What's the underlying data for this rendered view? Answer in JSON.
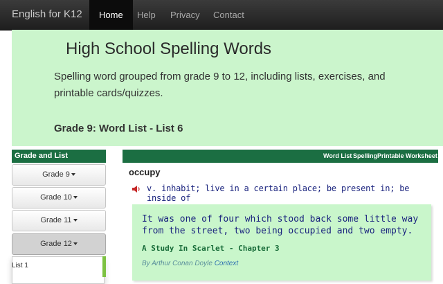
{
  "nav": {
    "brand": "English for K12",
    "items": [
      {
        "label": "Home",
        "active": true
      },
      {
        "label": "Help"
      },
      {
        "label": "Privacy"
      },
      {
        "label": "Contact"
      }
    ]
  },
  "hero": {
    "title": "High School Spelling Words",
    "description": "Spelling word grouped from grade 9 to 12, including lists, exercises, and printable cards/quizzes.",
    "subtitle": "Grade 9: Word List - List 6"
  },
  "sidebar": {
    "header": "Grade and List",
    "grades": [
      "Grade 9",
      "Grade 10",
      "Grade 11",
      "Grade 12"
    ],
    "dropdown_items": [
      "List 1"
    ]
  },
  "main": {
    "header_links": [
      "Word List",
      "Spelling",
      "Printable Worksheet"
    ],
    "word": "occupy",
    "definition": "v. inhabit; live in a certain place; be present in; be inside of",
    "quote": {
      "text": "It was one of four which stood back some little way from the street, two being occupied and two empty.",
      "source": "A Study In Scarlet - Chapter 3",
      "author": "By Arthur Conan Doyle",
      "context_link": "Context"
    }
  },
  "colors": {
    "nav_bg": "#2b2b2b",
    "hero_bg": "#cbf5cc",
    "section_header": "#1b6e42",
    "definition_text": "#1a237e",
    "source_text": "#176b38"
  }
}
